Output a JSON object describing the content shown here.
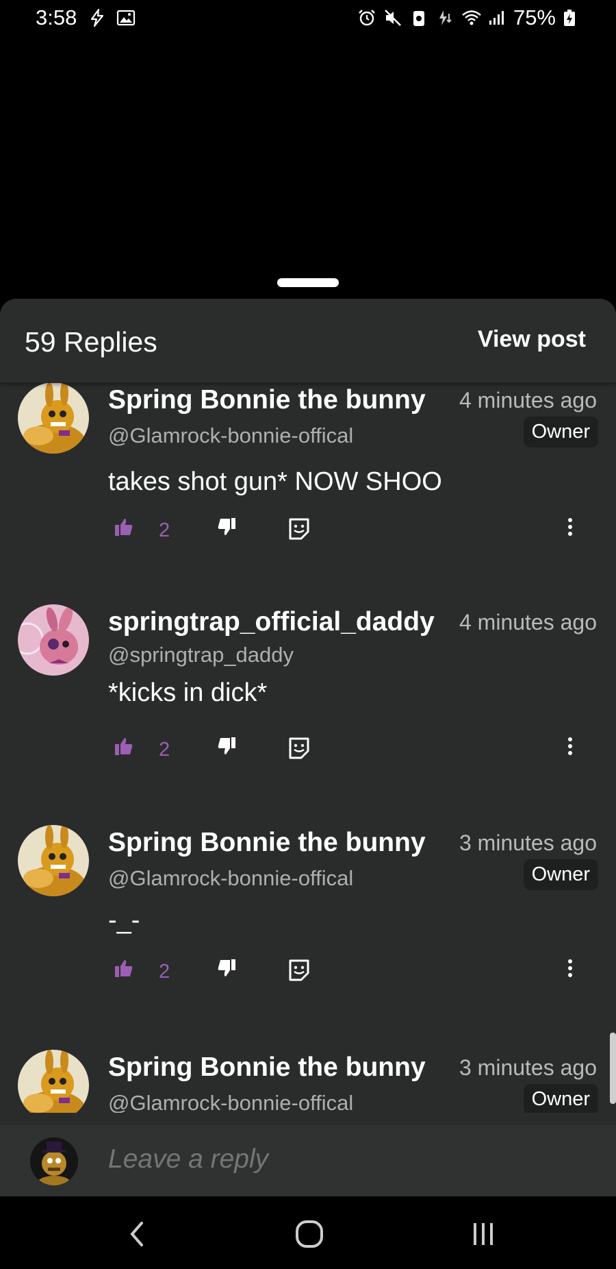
{
  "status_bar": {
    "time": "3:58",
    "battery": "75%",
    "left_icons": [
      "flash-icon",
      "image-icon"
    ],
    "right_icons": [
      "alarm-icon",
      "mute-icon",
      "data-saver-icon",
      "charging-icon",
      "wifi-icon",
      "signal-icon",
      "battery-icon"
    ]
  },
  "header": {
    "replies_label": "59 Replies",
    "view_post_label": "View post"
  },
  "comments": [
    {
      "username": "Spring Bonnie the bunny",
      "time": "4 minutes ago",
      "handle": "@Glamrock-bonnie-offical",
      "badge": "Owner",
      "text": "takes shot gun* NOW SHOO",
      "likes": "2"
    },
    {
      "username": "springtrap_official_daddy",
      "time": "4 minutes ago",
      "handle": "@springtrap_daddy",
      "badge": "",
      "text": "*kicks in dick*",
      "likes": "2"
    },
    {
      "username": "Spring Bonnie the bunny",
      "time": "3 minutes ago",
      "handle": "@Glamrock-bonnie-offical",
      "badge": "Owner",
      "text": "-_-",
      "likes": "2"
    },
    {
      "username": "Spring Bonnie the bunny",
      "time": "3 minutes ago",
      "handle": "@Glamrock-bonnie-offical",
      "badge": "Owner",
      "text": "",
      "likes": ""
    }
  ],
  "reply_bar": {
    "placeholder": "Leave a reply"
  },
  "colors": {
    "accent": "#9b5fb3",
    "sheet_bg": "#2a2c2b"
  }
}
